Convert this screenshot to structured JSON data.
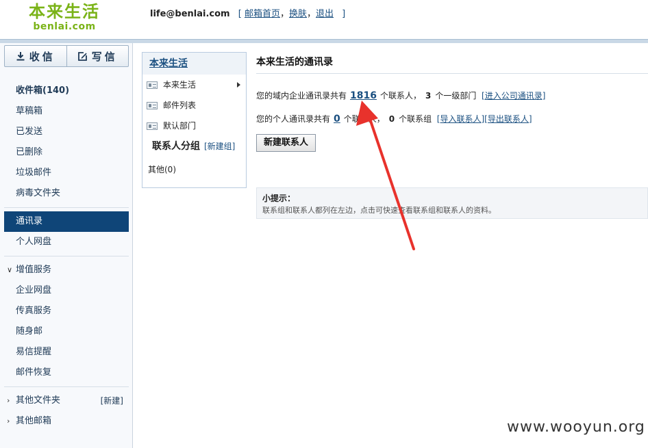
{
  "logo": {
    "cn": "本来生活",
    "en": "benlai.com"
  },
  "header": {
    "email": "life@benlai.com",
    "open": "[",
    "links": [
      "邮箱首页",
      "换肤",
      "退出"
    ],
    "sep1": "，",
    "sep2": "，",
    "close": "]"
  },
  "toolbar": {
    "receive_label": "收信",
    "compose_label": "写信"
  },
  "sidebar": {
    "inbox": "收件箱(140)",
    "items": [
      "草稿箱",
      "已发送",
      "已删除",
      "垃圾邮件",
      "病毒文件夹"
    ],
    "contacts": "通讯录",
    "netdisk": "个人网盘",
    "vas_title": "增值服务",
    "vas_items": [
      "企业网盘",
      "传真服务",
      "随身邮",
      "易信提醒",
      "邮件恢复"
    ],
    "other_folders": "其他文件夹",
    "new_folder": "[新建]",
    "other_mailbox": "其他邮箱"
  },
  "contact_panel": {
    "title": "本来生活",
    "rows": [
      "本来生活",
      "邮件列表",
      "默认部门"
    ],
    "group_heading": "联系人分组",
    "new_group": "[新建组]",
    "other_group": "其他(0)"
  },
  "main": {
    "title": "本来生活的通讯录",
    "l1_pre": "您的域内企业通讯录共有",
    "l1_count": "1816",
    "l1_mid": "个联系人，",
    "l1_depts": "3",
    "l1_post": "个一级部门",
    "l1_link": "[进入公司通讯录]",
    "l2_pre": "您的个人通讯录共有",
    "l2_count": "0",
    "l2_mid": "个联系人，",
    "l2_groups": "0",
    "l2_post": "个联系组",
    "import_link": "[导入联系人]",
    "export_link": "[导出联系人]",
    "new_contact_btn": "新建联系人",
    "tip_title": "小提示：",
    "tip_text": "联系组和联系人都列在左边，点击可快速查看联系组和联系人的资料。"
  },
  "watermark": "www.wooyun.org",
  "colors": {
    "brand_green": "#7ab317",
    "nav_active": "#0f4578",
    "link": "#1a4f80",
    "annotation_arrow": "#e8322c"
  }
}
